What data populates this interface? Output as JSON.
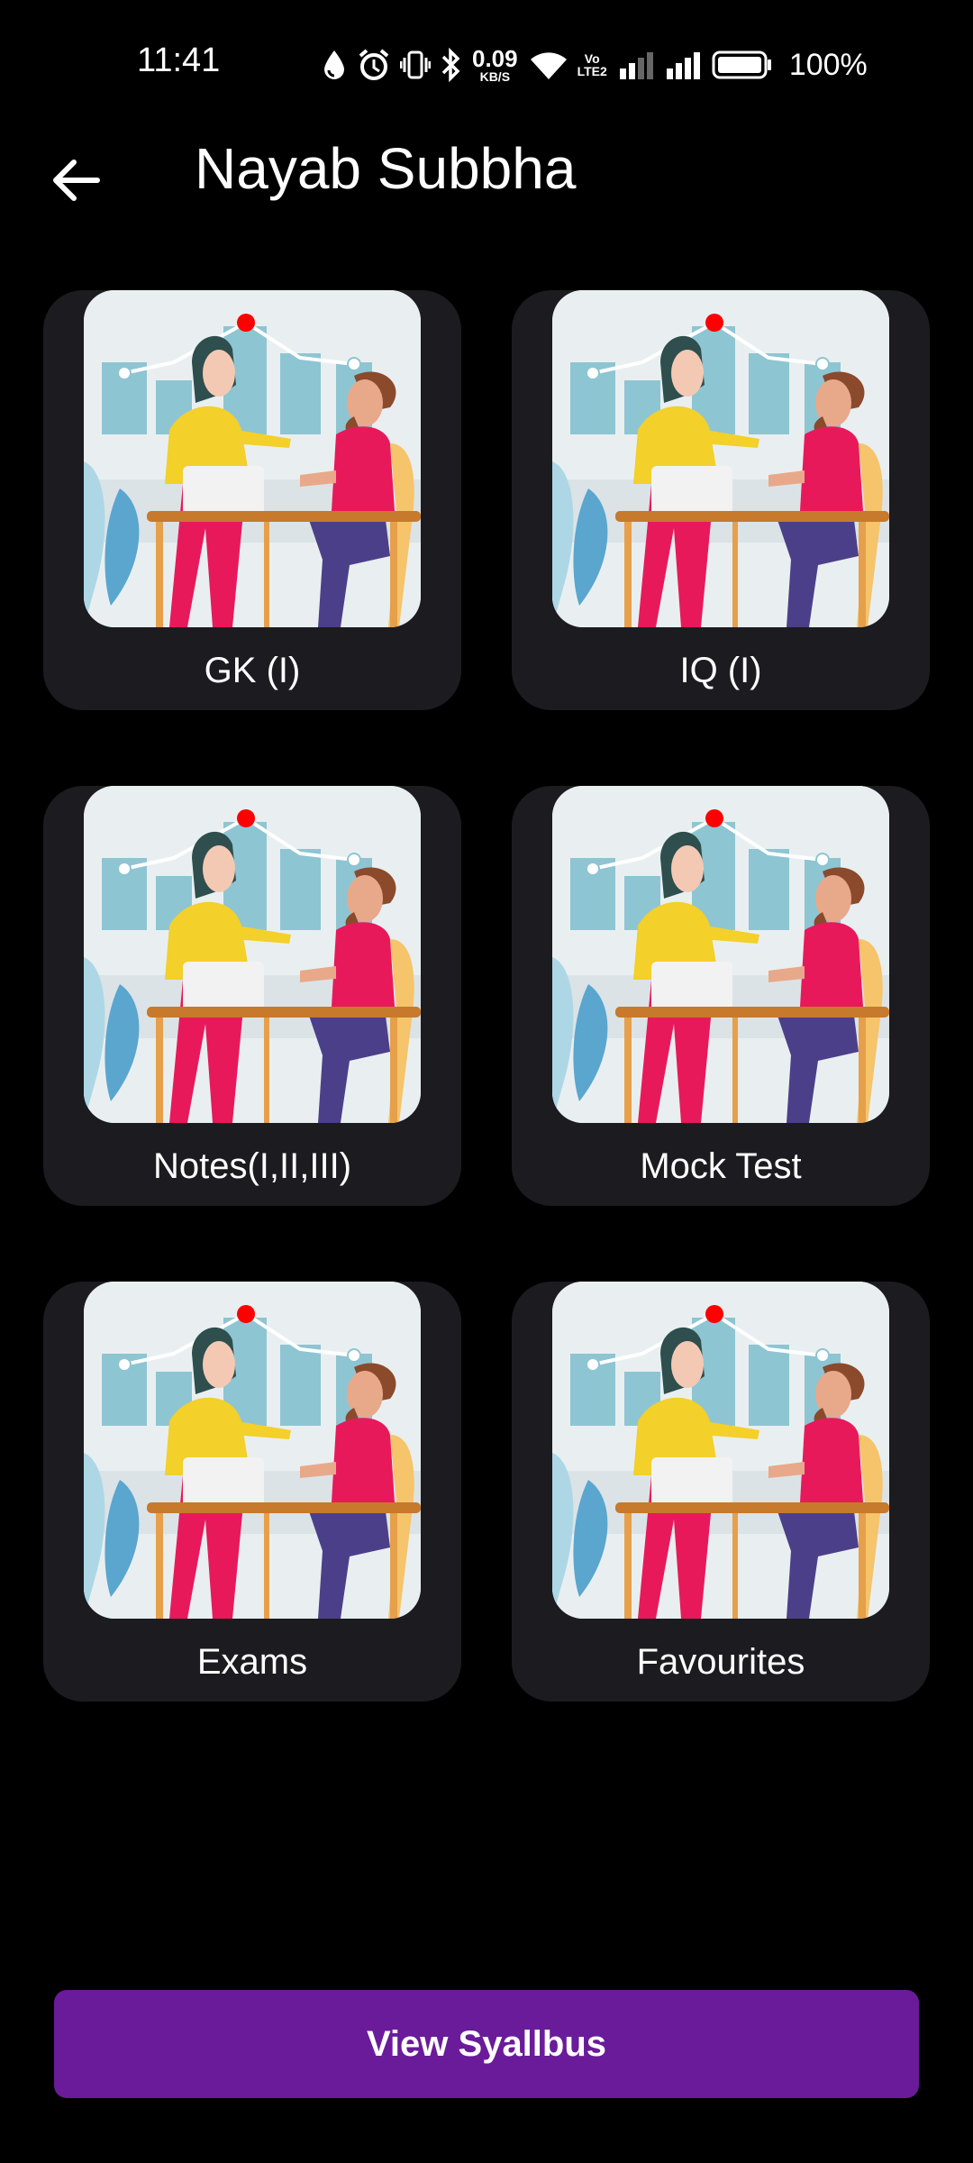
{
  "status_bar": {
    "time": "11:41",
    "net_speed_value": "0.09",
    "net_speed_unit": "KB/S",
    "volte_label_top": "Vo",
    "volte_label_bottom": "LTE2",
    "battery_percent": "100%",
    "icons": [
      "water-drop-icon",
      "alarm-icon",
      "vibrate-icon",
      "bluetooth-icon",
      "wifi-icon",
      "signal-icon",
      "signal-icon",
      "battery-icon"
    ]
  },
  "header": {
    "title": "Nayab Subbha",
    "back_icon": "arrow-left-icon"
  },
  "tiles": [
    {
      "label": "GK (I)"
    },
    {
      "label": "IQ (I)"
    },
    {
      "label": "Notes(I,II,III)"
    },
    {
      "label": "Mock Test"
    },
    {
      "label": "Exams"
    },
    {
      "label": "Favourites"
    }
  ],
  "cta": {
    "label": "View Syallbus"
  },
  "colors": {
    "background": "#000000",
    "card": "#1c1b20",
    "accent": "#6a1b9a"
  }
}
